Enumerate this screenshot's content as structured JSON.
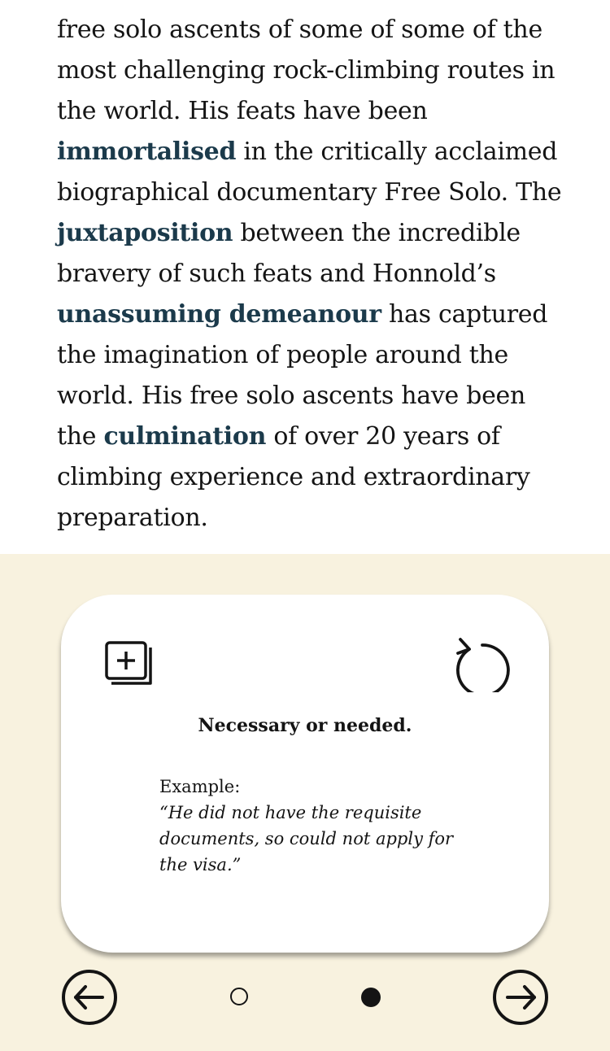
{
  "article": {
    "segments": [
      {
        "text": "free solo ascents of some of some of the most challenging rock-climbing routes in the world. His feats have been ",
        "highlight": false
      },
      {
        "text": "immortalised",
        "highlight": true
      },
      {
        "text": " in the critically acclaimed biographical documentary Free Solo. The ",
        "highlight": false
      },
      {
        "text": "juxtaposition",
        "highlight": true
      },
      {
        "text": " between the incredible bravery of such feats and Honnold’s ",
        "highlight": false
      },
      {
        "text": "unassuming demeanour",
        "highlight": true
      },
      {
        "text": " has captured the imagination of people around the world. His free solo ascents have been the ",
        "highlight": false
      },
      {
        "text": "culmination",
        "highlight": true
      },
      {
        "text": " of over 20 years of climbing experience and extraordinary preparation.",
        "highlight": false
      }
    ]
  },
  "card": {
    "add_icon": "add-to-deck-icon",
    "reset_icon": "rotate-icon",
    "definition": "Necessary or needed.",
    "example_label": "Example:",
    "example_text": "“He did not have the requisite documents, so could not apply for the visa.”"
  },
  "nav": {
    "prev_icon": "arrow-left-circle-icon",
    "next_icon": "arrow-right-circle-icon",
    "dots": [
      {
        "active": false
      },
      {
        "active": true
      }
    ]
  },
  "colors": {
    "highlight": "#1b3a4b",
    "panel_bg": "#f8f2df",
    "card_bg": "#ffffff",
    "text": "#141414"
  }
}
